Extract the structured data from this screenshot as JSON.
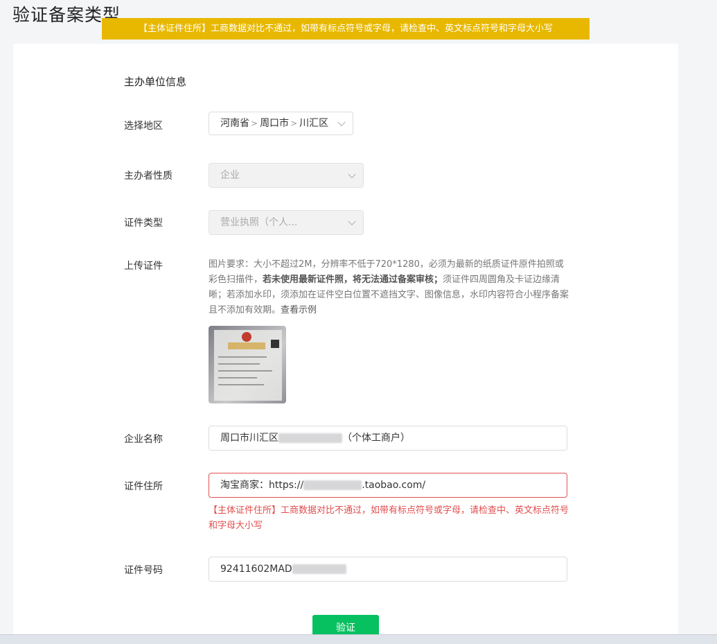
{
  "page": {
    "title": "验证备案类型",
    "banner": "【主体证件住所】工商数据对比不通过，如带有标点符号或字母，请检查中、英文标点符号和字母大小写"
  },
  "form": {
    "section_title": "主办单位信息",
    "region": {
      "label": "选择地区",
      "province": "河南省",
      "city": "周口市",
      "district": "川汇区"
    },
    "organizer_type": {
      "label": "主办者性质",
      "value": "企业"
    },
    "certificate_type": {
      "label": "证件类型",
      "value": "营业执照（个人..."
    },
    "upload": {
      "label": "上传证件",
      "req_text_1": "图片要求：大小不超过2M，分辨率不低于720*1280，必须为最新的纸质证件原件拍照或彩色扫描件，",
      "req_bold": "若未使用最新证件照，将无法通过备案审核；",
      "req_text_2": "须证件四周圆角及卡证边缘清晰；若添加水印，须添加在证件空白位置不遮挡文字、图像信息，水印内容符合小程序备案且不添加有效期。",
      "example_link": "查看示例"
    },
    "company_name": {
      "label": "企业名称",
      "prefix": "周口市川汇区",
      "suffix": "（个体工商户）"
    },
    "cert_address": {
      "label": "证件住所",
      "prefix": "淘宝商家：https://",
      "suffix": ".taobao.com/",
      "error": "【主体证件住所】工商数据对比不通过，如带有标点符号或字母，请检查中、英文标点符号和字母大小写"
    },
    "cert_number": {
      "label": "证件号码",
      "prefix": "92411602MAD"
    },
    "verify_button": "验证"
  }
}
